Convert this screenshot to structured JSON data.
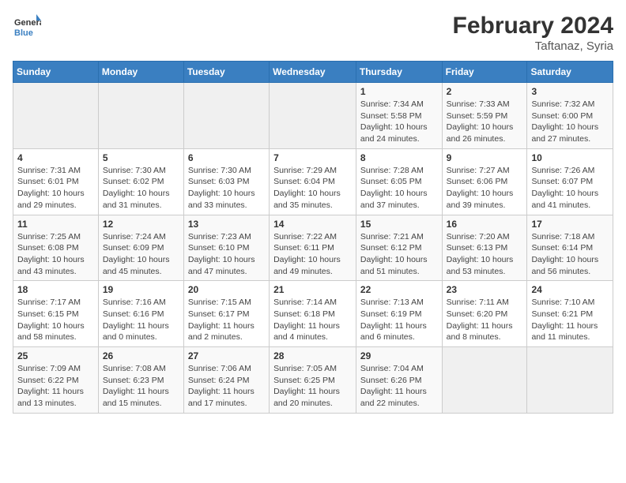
{
  "logo": {
    "line1": "General",
    "line2": "Blue"
  },
  "title": "February 2024",
  "subtitle": "Taftanaz, Syria",
  "headers": [
    "Sunday",
    "Monday",
    "Tuesday",
    "Wednesday",
    "Thursday",
    "Friday",
    "Saturday"
  ],
  "weeks": [
    [
      {
        "day": "",
        "info": ""
      },
      {
        "day": "",
        "info": ""
      },
      {
        "day": "",
        "info": ""
      },
      {
        "day": "",
        "info": ""
      },
      {
        "day": "1",
        "info": "Sunrise: 7:34 AM\nSunset: 5:58 PM\nDaylight: 10 hours and 24 minutes."
      },
      {
        "day": "2",
        "info": "Sunrise: 7:33 AM\nSunset: 5:59 PM\nDaylight: 10 hours and 26 minutes."
      },
      {
        "day": "3",
        "info": "Sunrise: 7:32 AM\nSunset: 6:00 PM\nDaylight: 10 hours and 27 minutes."
      }
    ],
    [
      {
        "day": "4",
        "info": "Sunrise: 7:31 AM\nSunset: 6:01 PM\nDaylight: 10 hours and 29 minutes."
      },
      {
        "day": "5",
        "info": "Sunrise: 7:30 AM\nSunset: 6:02 PM\nDaylight: 10 hours and 31 minutes."
      },
      {
        "day": "6",
        "info": "Sunrise: 7:30 AM\nSunset: 6:03 PM\nDaylight: 10 hours and 33 minutes."
      },
      {
        "day": "7",
        "info": "Sunrise: 7:29 AM\nSunset: 6:04 PM\nDaylight: 10 hours and 35 minutes."
      },
      {
        "day": "8",
        "info": "Sunrise: 7:28 AM\nSunset: 6:05 PM\nDaylight: 10 hours and 37 minutes."
      },
      {
        "day": "9",
        "info": "Sunrise: 7:27 AM\nSunset: 6:06 PM\nDaylight: 10 hours and 39 minutes."
      },
      {
        "day": "10",
        "info": "Sunrise: 7:26 AM\nSunset: 6:07 PM\nDaylight: 10 hours and 41 minutes."
      }
    ],
    [
      {
        "day": "11",
        "info": "Sunrise: 7:25 AM\nSunset: 6:08 PM\nDaylight: 10 hours and 43 minutes."
      },
      {
        "day": "12",
        "info": "Sunrise: 7:24 AM\nSunset: 6:09 PM\nDaylight: 10 hours and 45 minutes."
      },
      {
        "day": "13",
        "info": "Sunrise: 7:23 AM\nSunset: 6:10 PM\nDaylight: 10 hours and 47 minutes."
      },
      {
        "day": "14",
        "info": "Sunrise: 7:22 AM\nSunset: 6:11 PM\nDaylight: 10 hours and 49 minutes."
      },
      {
        "day": "15",
        "info": "Sunrise: 7:21 AM\nSunset: 6:12 PM\nDaylight: 10 hours and 51 minutes."
      },
      {
        "day": "16",
        "info": "Sunrise: 7:20 AM\nSunset: 6:13 PM\nDaylight: 10 hours and 53 minutes."
      },
      {
        "day": "17",
        "info": "Sunrise: 7:18 AM\nSunset: 6:14 PM\nDaylight: 10 hours and 56 minutes."
      }
    ],
    [
      {
        "day": "18",
        "info": "Sunrise: 7:17 AM\nSunset: 6:15 PM\nDaylight: 10 hours and 58 minutes."
      },
      {
        "day": "19",
        "info": "Sunrise: 7:16 AM\nSunset: 6:16 PM\nDaylight: 11 hours and 0 minutes."
      },
      {
        "day": "20",
        "info": "Sunrise: 7:15 AM\nSunset: 6:17 PM\nDaylight: 11 hours and 2 minutes."
      },
      {
        "day": "21",
        "info": "Sunrise: 7:14 AM\nSunset: 6:18 PM\nDaylight: 11 hours and 4 minutes."
      },
      {
        "day": "22",
        "info": "Sunrise: 7:13 AM\nSunset: 6:19 PM\nDaylight: 11 hours and 6 minutes."
      },
      {
        "day": "23",
        "info": "Sunrise: 7:11 AM\nSunset: 6:20 PM\nDaylight: 11 hours and 8 minutes."
      },
      {
        "day": "24",
        "info": "Sunrise: 7:10 AM\nSunset: 6:21 PM\nDaylight: 11 hours and 11 minutes."
      }
    ],
    [
      {
        "day": "25",
        "info": "Sunrise: 7:09 AM\nSunset: 6:22 PM\nDaylight: 11 hours and 13 minutes."
      },
      {
        "day": "26",
        "info": "Sunrise: 7:08 AM\nSunset: 6:23 PM\nDaylight: 11 hours and 15 minutes."
      },
      {
        "day": "27",
        "info": "Sunrise: 7:06 AM\nSunset: 6:24 PM\nDaylight: 11 hours and 17 minutes."
      },
      {
        "day": "28",
        "info": "Sunrise: 7:05 AM\nSunset: 6:25 PM\nDaylight: 11 hours and 20 minutes."
      },
      {
        "day": "29",
        "info": "Sunrise: 7:04 AM\nSunset: 6:26 PM\nDaylight: 11 hours and 22 minutes."
      },
      {
        "day": "",
        "info": ""
      },
      {
        "day": "",
        "info": ""
      }
    ]
  ]
}
